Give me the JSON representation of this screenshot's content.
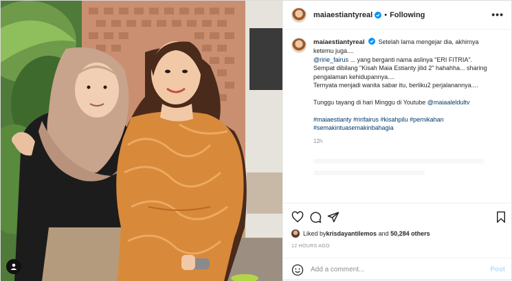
{
  "post": {
    "author": "maiaestiantyreal",
    "follow_status": "Following",
    "more_label": "•••",
    "caption": {
      "author": "maiaestiantyreal",
      "line1": "Setelah lama mengejar dia, akhirnya ketemu juga....",
      "mention1": "@ririe_fairus",
      "line2": " ... yang berganti nama aslinya \"ERI FITRIA\".",
      "line3": "Sempat dibilang \"Kisah Maia Estianty jilid 2\" hahahha... sharing pengalaman kehidupannya....",
      "line4": "Ternyata menjadi wanita sabar itu, berliku2 perjalanannya....",
      "line5": "Tunggu tayang di hari Minggu di Youtube ",
      "mention2": "@maiaaleldultv",
      "hashtags": "#maiaestianty #ririfairus #kisahpilu #pernikahan #semakintuasemakinbahagia",
      "time": "12h"
    },
    "likes": {
      "prefix": "Liked by ",
      "user": "krisdayantilemos",
      "middle": " and ",
      "others": "50,284 others"
    },
    "time_ago": "12 HOURS AGO",
    "comment_placeholder": "Add a comment...",
    "post_button": "Post"
  },
  "icons": {
    "verified": "verified-badge-icon",
    "like": "heart-icon",
    "comment": "comment-icon",
    "share": "share-icon",
    "save": "bookmark-icon",
    "emoji": "emoji-icon",
    "user_tag": "user-tag-icon"
  },
  "colors": {
    "verified": "#0095f6",
    "link": "#00376b",
    "muted": "#8e8e8e",
    "post_disabled": "#b2dffc",
    "dress": "#d9893a"
  }
}
